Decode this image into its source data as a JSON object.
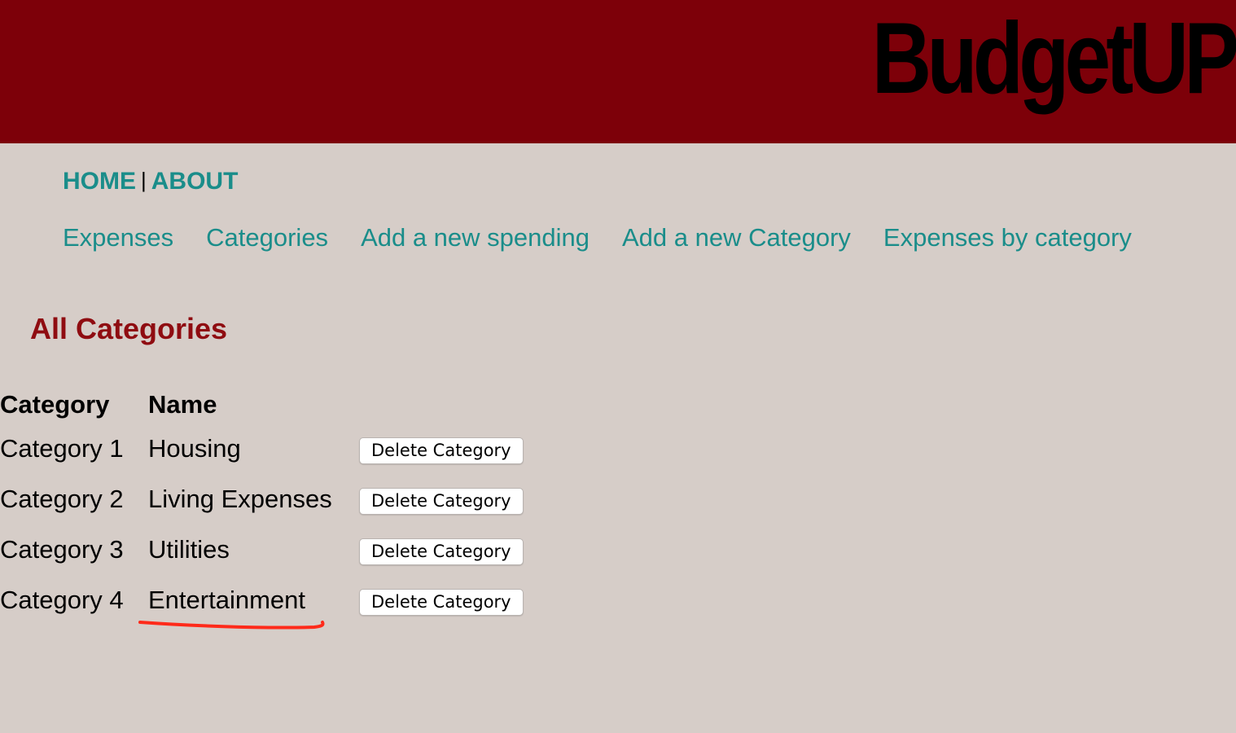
{
  "header": {
    "brand": "BudgetUP",
    "background": "#7d0009"
  },
  "top_nav": {
    "home": "HOME",
    "separator": "|",
    "about": "ABOUT"
  },
  "sub_nav": [
    {
      "label": "Expenses"
    },
    {
      "label": "Categories"
    },
    {
      "label": "Add a new spending"
    },
    {
      "label": "Add a new Category"
    },
    {
      "label": "Expenses by category"
    }
  ],
  "heading": "All Categories",
  "table": {
    "headers": [
      "Category",
      "Name"
    ],
    "rows": [
      {
        "category": "Category 1",
        "name": "Housing",
        "action": "Delete Category"
      },
      {
        "category": "Category 2",
        "name": "Living Expenses",
        "action": "Delete Category"
      },
      {
        "category": "Category 3",
        "name": "Utilities",
        "action": "Delete Category"
      },
      {
        "category": "Category 4",
        "name": "Entertainment",
        "action": "Delete Category"
      }
    ]
  },
  "colors": {
    "link": "#1a8d8a",
    "heading": "#8f0c11",
    "page_bg": "#d6cdc8",
    "annotation": "#ff2a1a"
  }
}
